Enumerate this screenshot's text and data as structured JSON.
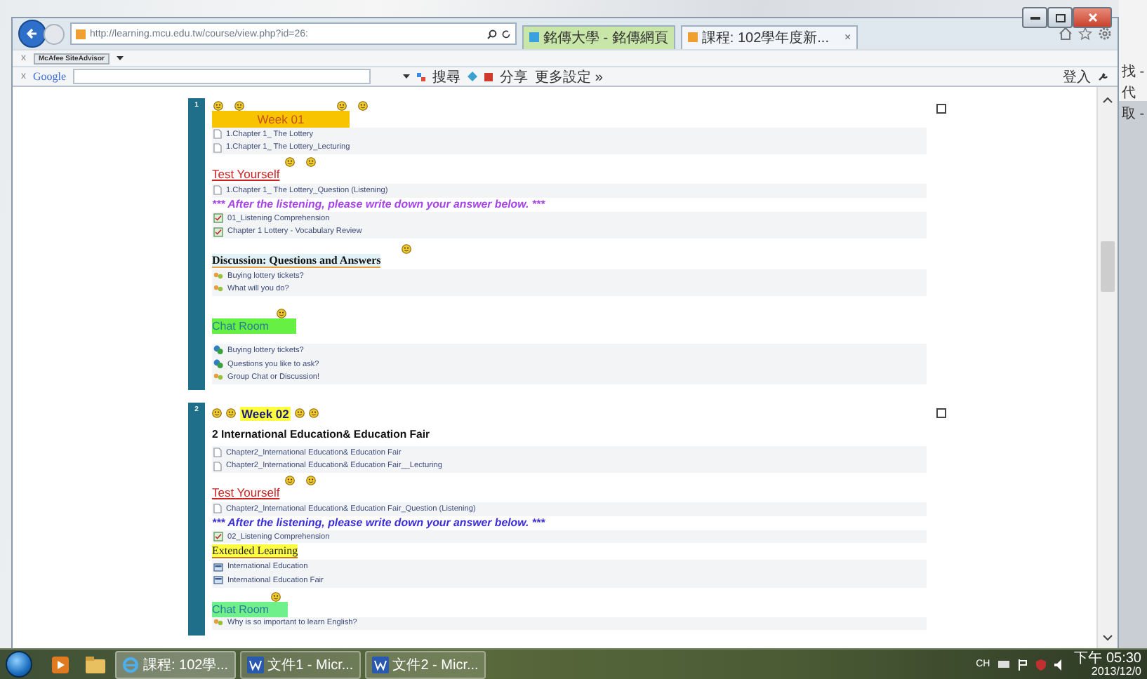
{
  "browser": {
    "address": "http://learning.mcu.edu.tw/course/view.php?id=26:",
    "tabs": [
      {
        "label": "銘傳大學 - 銘傳網頁",
        "selected": false
      },
      {
        "label": "課程: 102學年度新...",
        "selected": true,
        "close": "×"
      }
    ]
  },
  "mcafee_bar": {
    "close": "x",
    "label": "McAfee SiteAdvisor"
  },
  "google_bar": {
    "close": "x",
    "logo": "Google",
    "search": "搜尋",
    "share": "分享",
    "more": "更多設定 »",
    "signin": "登入"
  },
  "sections": [
    {
      "number": "1",
      "items": [
        {
          "kind": "week-banner",
          "text": "Week 01"
        },
        {
          "kind": "page-link",
          "text": "1.Chapter 1_ The Lottery"
        },
        {
          "kind": "page-link",
          "text": "1.Chapter 1_ The Lottery_Lecturing"
        },
        {
          "kind": "test-link",
          "text": "Test Yourself"
        },
        {
          "kind": "page-link",
          "text": "1.Chapter 1_ The Lottery_Question (Listening)"
        },
        {
          "kind": "notice",
          "color": "#a545e8",
          "text": "*** After the listening, please write down your answer below. ***"
        },
        {
          "kind": "quiz-link",
          "text": "01_Listening Comprehension"
        },
        {
          "kind": "quiz-link",
          "text": "Chapter 1 Lottery - Vocabulary Review"
        },
        {
          "kind": "discussion-heading",
          "text": "**Discussion: Questions and Answers**"
        },
        {
          "kind": "forum-link",
          "text": "Buying lottery tickets?"
        },
        {
          "kind": "forum-link",
          "text": "What will you do?"
        },
        {
          "kind": "chat-heading",
          "text": "Chat Room"
        },
        {
          "kind": "chat-link",
          "text": "Buying lottery tickets?"
        },
        {
          "kind": "chat-link",
          "text": "Questions you like to ask?"
        },
        {
          "kind": "forum-link",
          "text": "Group Chat or Discussion!"
        }
      ]
    },
    {
      "number": "2",
      "items": [
        {
          "kind": "week-tag",
          "text": "**Week 02**"
        },
        {
          "kind": "topic-title",
          "text": "**2 International Education& Education Fair**"
        },
        {
          "kind": "page-link",
          "text": "Chapter2_International Education& Education Fair"
        },
        {
          "kind": "page-link",
          "text": "Chapter2_International Education& Education Fair__Lecturing"
        },
        {
          "kind": "test-link",
          "text": "Test Yourself"
        },
        {
          "kind": "page-link",
          "text": "Chapter2_International Education& Education Fair_Question (Listening)"
        },
        {
          "kind": "notice",
          "color": "#3b2fd6",
          "text": "*** After the listening, please write down your answer below. ***"
        },
        {
          "kind": "quiz-link",
          "text": "02_Listening Comprehension"
        },
        {
          "kind": "extended-heading",
          "text": "Extended Learning"
        },
        {
          "kind": "url-link",
          "text": "International Education"
        },
        {
          "kind": "url-link",
          "text": "International Education Fair"
        },
        {
          "kind": "chat-heading",
          "text": "Chat Room"
        },
        {
          "kind": "forum-link",
          "text": "Why is so important to learn English?"
        }
      ]
    }
  ],
  "back_window": {
    "lines": [
      "找 -",
      "代",
      "取 -"
    ]
  },
  "taskbar": {
    "buttons": [
      {
        "kind": "ie",
        "label": "課程: 102學..."
      },
      {
        "kind": "word",
        "label": "文件1 - Micr..."
      },
      {
        "kind": "word",
        "label": "文件2 - Micr..."
      }
    ],
    "language": "CH",
    "time": "下午 05:30",
    "date": "2013/12/0"
  }
}
